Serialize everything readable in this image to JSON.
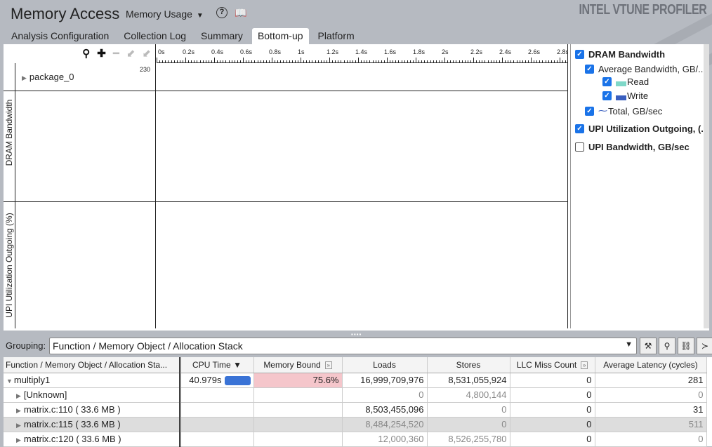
{
  "header": {
    "title": "Memory Access",
    "analysis_type": "Memory Usage",
    "brand": "INTEL VTUNE PROFILER"
  },
  "tabs": [
    {
      "label": "Analysis Configuration"
    },
    {
      "label": "Collection Log"
    },
    {
      "label": "Summary"
    },
    {
      "label": "Bottom-up",
      "active": true
    },
    {
      "label": "Platform"
    }
  ],
  "timeline": {
    "ticks": [
      "0s",
      "0.2s",
      "0.4s",
      "0.6s",
      "0.8s",
      "1s",
      "1.2s",
      "1.4s",
      "1.6s",
      "1.8s",
      "2s",
      "2.2s",
      "2.4s",
      "2.6s",
      "2.8s"
    ],
    "row": "package_0",
    "row_max": "230",
    "lanes": [
      "DRAM Bandwidth",
      "UPI Utilization Outgoing (%)"
    ]
  },
  "legend": {
    "dram": "DRAM Bandwidth",
    "avg": "Average Bandwidth, GB/...",
    "read": "Read",
    "write": "Write",
    "total": "Total, GB/sec",
    "upi_util": "UPI Utilization Outgoing, (...",
    "upi_bw": "UPI Bandwidth, GB/sec",
    "colors": {
      "read": "#7fd8c8",
      "write": "#3a5fbf",
      "check": "#1a73e8"
    }
  },
  "grouping": {
    "label": "Grouping:",
    "value": "Function / Memory Object / Allocation Stack"
  },
  "grid": {
    "columns": [
      "Function / Memory Object / Allocation Sta...",
      "CPU Time",
      "Memory Bound",
      "Loads",
      "Stores",
      "LLC Miss Count",
      "Average Latency (cycles)"
    ],
    "rows": [
      {
        "name": "multiply1",
        "cpu": "40.979s",
        "cpu_fraction": 1.0,
        "mb": "75.6%",
        "loads": "16,999,709,976",
        "stores": "8,531,055,924",
        "llc": "0",
        "lat": "281"
      },
      {
        "name": "[Unknown]",
        "cpu": "",
        "mb": "",
        "loads": "0",
        "stores": "4,800,144",
        "llc": "0",
        "lat": "0"
      },
      {
        "name": "matrix.c:110 ( 33.6 MB )",
        "cpu": "",
        "mb": "",
        "loads": "8,503,455,096",
        "stores": "0",
        "llc": "0",
        "lat": "31"
      },
      {
        "name": "matrix.c:115 ( 33.6 MB )",
        "cpu": "",
        "mb": "",
        "loads": "8,484,254,520",
        "stores": "0",
        "llc": "0",
        "lat": "511"
      },
      {
        "name": "matrix.c:120 ( 33.6 MB )",
        "cpu": "",
        "mb": "",
        "loads": "12,000,360",
        "stores": "8,526,255,780",
        "llc": "0",
        "lat": "0"
      }
    ]
  }
}
